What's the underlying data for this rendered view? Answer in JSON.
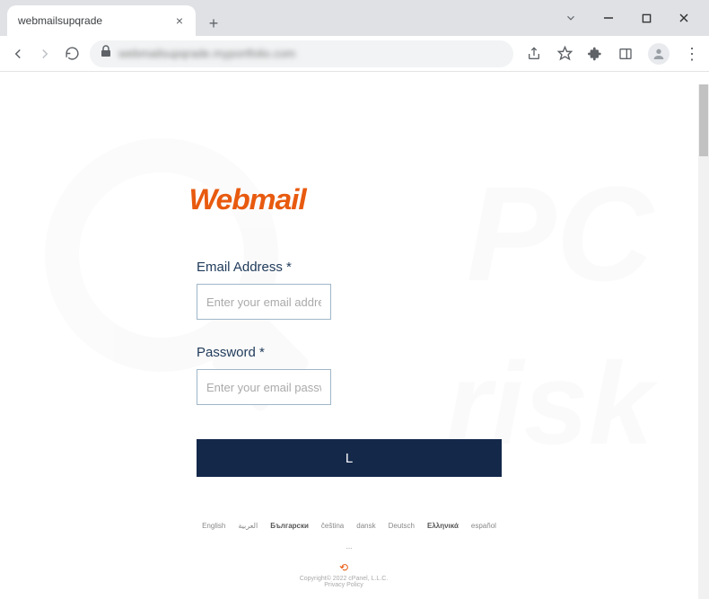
{
  "browser": {
    "tab_title": "webmailsupqrade",
    "url_display": "webmailsupqrade.myportfolio.com"
  },
  "page": {
    "logo_text": "Webmail",
    "fields": {
      "email_label": "Email Address *",
      "email_placeholder": "Enter your email addre",
      "password_label": "Password *",
      "password_placeholder": "Enter your email passw"
    },
    "login_button_label": "L",
    "languages": [
      "English",
      "العربية",
      "Български",
      "čeština",
      "dansk",
      "Deutsch",
      "Ελληνικά",
      "español",
      "..."
    ],
    "languages_bold": [
      2,
      6
    ],
    "footer": {
      "copyright": "Copyright© 2022 cPanel, L.L.C.",
      "privacy": "Privacy Policy"
    }
  }
}
